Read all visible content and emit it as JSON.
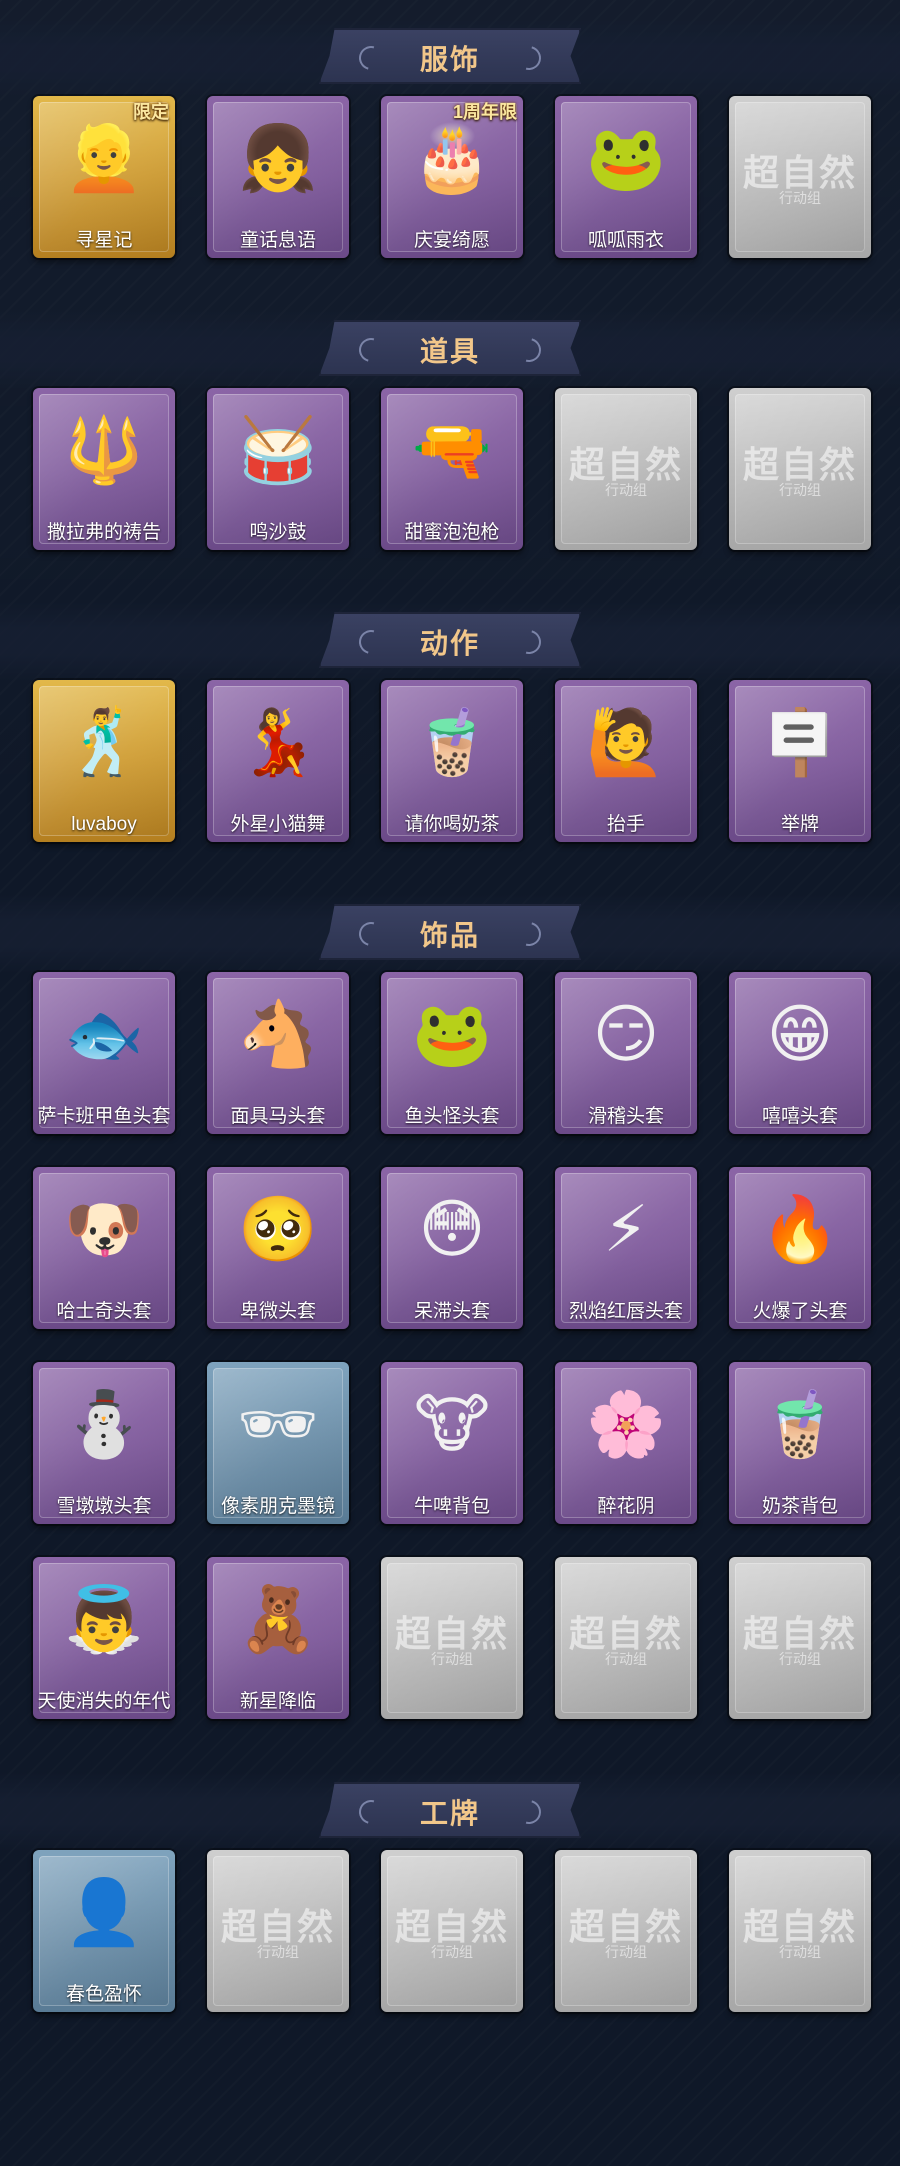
{
  "sections": [
    {
      "title": "服饰",
      "items": [
        {
          "label": "寻星记",
          "style": "gold",
          "icon": "character-portrait-icon",
          "glyph": "👱",
          "tag": "限定"
        },
        {
          "label": "童话息语",
          "style": "purple",
          "icon": "character-portrait-icon",
          "glyph": "👧"
        },
        {
          "label": "庆宴绮愿",
          "style": "purple",
          "icon": "character-portrait-icon",
          "glyph": "🎂",
          "tag": "1周年限"
        },
        {
          "label": "呱呱雨衣",
          "style": "purple",
          "icon": "character-portrait-icon",
          "glyph": "🐸"
        },
        {
          "label": "",
          "style": "grey",
          "icon": "locked-placeholder-icon",
          "watermark": "超自然",
          "watermark_sub": "行动组"
        }
      ]
    },
    {
      "title": "道具",
      "items": [
        {
          "label": "撒拉弗的祷告",
          "style": "purple",
          "icon": "staff-icon",
          "glyph": "🔱"
        },
        {
          "label": "鸣沙鼓",
          "style": "purple",
          "icon": "drum-icon",
          "glyph": "🥁"
        },
        {
          "label": "甜蜜泡泡枪",
          "style": "purple",
          "icon": "bubble-gun-icon",
          "glyph": "🔫"
        },
        {
          "label": "",
          "style": "grey",
          "icon": "locked-placeholder-icon",
          "watermark": "超自然",
          "watermark_sub": "行动组"
        },
        {
          "label": "",
          "style": "grey",
          "icon": "locked-placeholder-icon",
          "watermark": "超自然",
          "watermark_sub": "行动组"
        }
      ]
    },
    {
      "title": "动作",
      "items": [
        {
          "label": "luvaboy",
          "style": "gold",
          "icon": "pose-icon",
          "glyph": "🕺"
        },
        {
          "label": "外星小猫舞",
          "style": "purple",
          "icon": "pose-icon",
          "glyph": "💃"
        },
        {
          "label": "请你喝奶茶",
          "style": "purple",
          "icon": "pose-icon",
          "glyph": "🧋"
        },
        {
          "label": "抬手",
          "style": "purple",
          "icon": "pose-icon",
          "glyph": "🙋"
        },
        {
          "label": "举牌",
          "style": "purple",
          "icon": "sign-icon",
          "glyph": "🪧"
        }
      ]
    },
    {
      "title": "饰品",
      "items": [
        {
          "label": "萨卡班甲鱼头套",
          "style": "purple",
          "icon": "fish-head-icon",
          "glyph": "🐟"
        },
        {
          "label": "面具马头套",
          "style": "purple",
          "icon": "horse-head-icon",
          "glyph": "🐴"
        },
        {
          "label": "鱼头怪头套",
          "style": "purple",
          "icon": "fish-monster-icon",
          "glyph": "🐸"
        },
        {
          "label": "滑稽头套",
          "style": "purple",
          "icon": "emoji-face-icon",
          "glyph": "😏"
        },
        {
          "label": "嘻嘻头套",
          "style": "purple",
          "icon": "emoji-face-icon",
          "glyph": "😁"
        },
        {
          "label": "哈士奇头套",
          "style": "purple",
          "icon": "dog-head-icon",
          "glyph": "🐶"
        },
        {
          "label": "卑微头套",
          "style": "purple",
          "icon": "emoji-face-icon",
          "glyph": "🥺"
        },
        {
          "label": "呆滞头套",
          "style": "purple",
          "icon": "emoji-face-icon",
          "glyph": "😳"
        },
        {
          "label": "烈焰红唇头套",
          "style": "purple",
          "icon": "pikachu-head-icon",
          "glyph": "⚡"
        },
        {
          "label": "火爆了头套",
          "style": "purple",
          "icon": "fire-icon",
          "glyph": "🔥"
        },
        {
          "label": "雪墩墩头套",
          "style": "purple",
          "icon": "snowman-icon",
          "glyph": "⛄"
        },
        {
          "label": "像素朋克墨镜",
          "style": "blue",
          "icon": "pixel-sunglasses-icon",
          "glyph": "🕶"
        },
        {
          "label": "牛啤背包",
          "style": "purple",
          "icon": "cow-backpack-icon",
          "glyph": "🐮"
        },
        {
          "label": "醉花阴",
          "style": "purple",
          "icon": "flower-ornament-icon",
          "glyph": "🌸"
        },
        {
          "label": "奶茶背包",
          "style": "purple",
          "icon": "milk-tea-backpack-icon",
          "glyph": "🧋"
        },
        {
          "label": "天使消失的年代",
          "style": "purple",
          "icon": "angel-icon",
          "glyph": "👼"
        },
        {
          "label": "新星降临",
          "style": "purple",
          "icon": "keychain-icon",
          "glyph": "🧸"
        },
        {
          "label": "",
          "style": "grey",
          "icon": "locked-placeholder-icon",
          "watermark": "超自然",
          "watermark_sub": "行动组"
        },
        {
          "label": "",
          "style": "grey",
          "icon": "locked-placeholder-icon",
          "watermark": "超自然",
          "watermark_sub": "行动组"
        },
        {
          "label": "",
          "style": "grey",
          "icon": "locked-placeholder-icon",
          "watermark": "超自然",
          "watermark_sub": "行动组"
        }
      ]
    },
    {
      "title": "工牌",
      "items": [
        {
          "label": "春色盈怀",
          "style": "blue",
          "icon": "badge-silhouette-icon",
          "glyph": "👤"
        },
        {
          "label": "",
          "style": "grey",
          "icon": "locked-placeholder-icon",
          "watermark": "超自然",
          "watermark_sub": "行动组"
        },
        {
          "label": "",
          "style": "grey",
          "icon": "locked-placeholder-icon",
          "watermark": "超自然",
          "watermark_sub": "行动组"
        },
        {
          "label": "",
          "style": "grey",
          "icon": "locked-placeholder-icon",
          "watermark": "超自然",
          "watermark_sub": "行动组"
        },
        {
          "label": "",
          "style": "grey",
          "icon": "locked-placeholder-icon",
          "watermark": "超自然",
          "watermark_sub": "行动组"
        }
      ]
    }
  ],
  "colors": {
    "background": "#0f1828",
    "title_gold": "#f2c78a",
    "card_purple": "#7f5a9c",
    "card_gold": "#cf9c33",
    "card_blue": "#6b8ea8",
    "card_grey": "#b9b9b9"
  }
}
